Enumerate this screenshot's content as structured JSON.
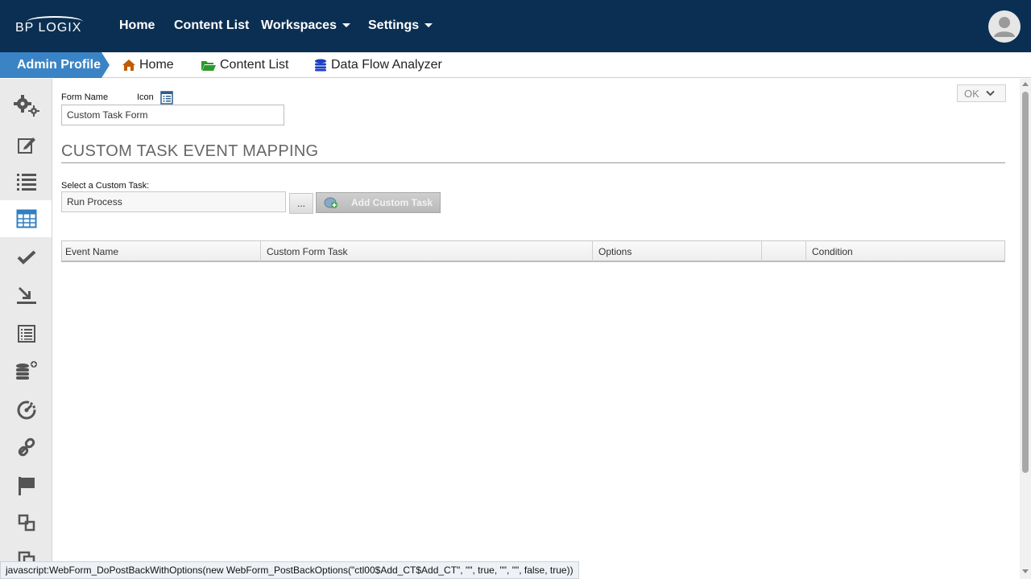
{
  "brand": {
    "logo_text": "BP LOGIX"
  },
  "topnav": {
    "items": [
      {
        "label": "Home"
      },
      {
        "label": "Content List"
      },
      {
        "label": "Workspaces"
      },
      {
        "label": "Settings"
      }
    ]
  },
  "breadcrumb": {
    "profile": "Admin Profile",
    "items": [
      {
        "label": "Home",
        "icon": "home-icon",
        "color": "#c25b00"
      },
      {
        "label": "Content List",
        "icon": "folder-open-icon",
        "color": "#2a9a2a"
      },
      {
        "label": "Data Flow Analyzer",
        "icon": "database-icon",
        "color": "#1a3fc4"
      }
    ]
  },
  "sidebar": {
    "items": [
      {
        "icon": "gears-icon"
      },
      {
        "icon": "edit-icon"
      },
      {
        "icon": "list-icon"
      },
      {
        "icon": "table-icon",
        "active": true
      },
      {
        "icon": "check-icon"
      },
      {
        "icon": "download-tray-icon"
      },
      {
        "icon": "document-list-icon"
      },
      {
        "icon": "database-add-icon"
      },
      {
        "icon": "dashboard-icon"
      },
      {
        "icon": "link-icon"
      },
      {
        "icon": "flag-icon"
      },
      {
        "icon": "transfer-icon"
      },
      {
        "icon": "copy-icon"
      }
    ]
  },
  "form": {
    "form_name_label": "Form Name",
    "icon_label": "Icon",
    "form_name_value": "Custom Task Form",
    "ok_label": "OK"
  },
  "section": {
    "title": "CUSTOM TASK EVENT MAPPING",
    "select_label": "Select a Custom Task:",
    "selected_task": "Run Process",
    "browse_label": "...",
    "add_label": "Add Custom Task"
  },
  "table": {
    "columns": [
      "Event Name",
      "Custom Form Task",
      "Options",
      "",
      "Condition"
    ]
  },
  "status": {
    "text": "javascript:WebForm_DoPostBackWithOptions(new WebForm_PostBackOptions(\"ctl00$Add_CT$Add_CT\", \"\", true, \"\", \"\", false, true))"
  },
  "colors": {
    "navbar": "#0b2f52",
    "accent": "#3a84c6",
    "sidebar_icon": "#4a4a4a",
    "active_icon": "#2f7fc1"
  }
}
